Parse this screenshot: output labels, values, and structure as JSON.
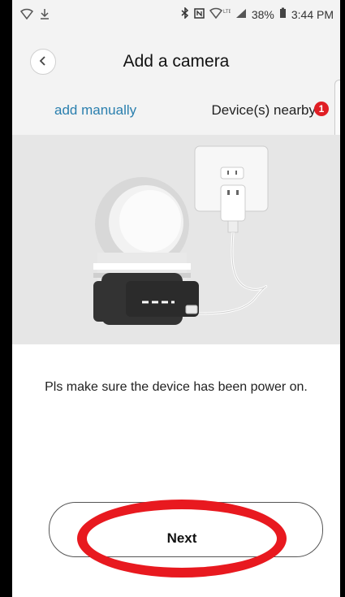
{
  "status_bar": {
    "left_icons": [
      "wifi-icon",
      "download-icon"
    ],
    "right_icons": [
      "bluetooth-icon",
      "nfc-icon",
      "wifi-lte-icon",
      "signal-icon",
      "battery-icon"
    ],
    "battery": "38%",
    "time": "3:44 PM"
  },
  "header": {
    "back_icon": "chevron-left-icon",
    "title": "Add a camera"
  },
  "tabs": {
    "manual": "add manually",
    "nearby": "Device(s) nearby",
    "nearby_badge": "1"
  },
  "content": {
    "message": "Pls make sure the device has been power on."
  },
  "actions": {
    "next_label": "Next"
  },
  "colors": {
    "accent": "#2a7fae",
    "badge": "#e01e24",
    "annotation": "#e8191f",
    "illustration_bg": "#e6e6e6"
  }
}
